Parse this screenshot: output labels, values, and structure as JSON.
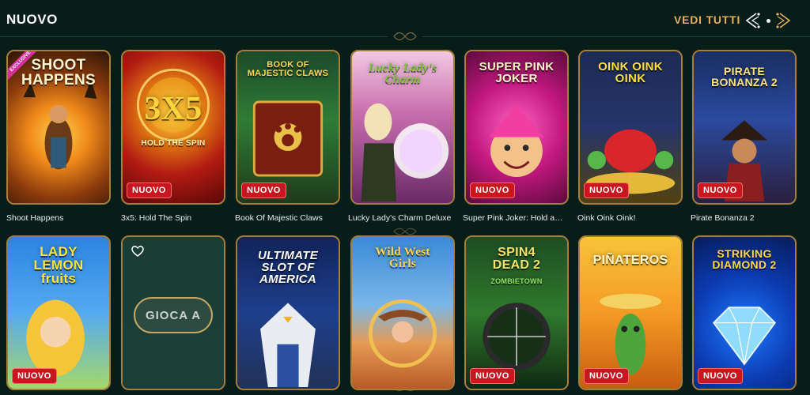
{
  "header": {
    "section_title": "NUOVO",
    "view_all_label": "VEDI TUTTI",
    "accent_color": "#e7b05a"
  },
  "badge_label": "NUOVO",
  "rows": [
    {
      "games": [
        {
          "name": "Shoot Happens",
          "logo": "SHOOT HAPPENS",
          "exclusive": "EXCLUSIVE",
          "badge": false
        },
        {
          "name": "3x5: Hold The Spin",
          "logo": "3X5",
          "sub": "HOLD THE SPIN",
          "badge": true
        },
        {
          "name": "Book Of Majestic Claws",
          "logo": "BOOK OF MAJESTIC CLAWS",
          "badge": true
        },
        {
          "name": "Lucky Lady's Charm Deluxe",
          "logo": "Lucky Lady's Charm",
          "badge": false
        },
        {
          "name": "Super Pink Joker: Hold and Win",
          "logo": "SUPER PINK JOKER",
          "badge": true
        },
        {
          "name": "Oink Oink Oink!",
          "logo": "OINK OINK OINK",
          "badge": true
        },
        {
          "name": "Pirate Bonanza 2",
          "logo": "PIRATE BONANZA 2",
          "badge": true
        }
      ]
    },
    {
      "games": [
        {
          "logo": "LADY LEMON fruits",
          "badge": true
        },
        {
          "logo": "",
          "play_label": "GIOCA A",
          "badge": false
        },
        {
          "logo": "ULTIMATE SLOT OF AMERICA",
          "badge": false
        },
        {
          "logo": "Wild West Girls",
          "badge": false
        },
        {
          "logo": "SPIN4 DEAD 2",
          "sub": "ZOMBIETOWN",
          "badge": true
        },
        {
          "logo": "PIÑATEROS",
          "badge": true
        },
        {
          "logo": "STRIKING DIAMOND 2",
          "badge": true
        }
      ]
    }
  ]
}
